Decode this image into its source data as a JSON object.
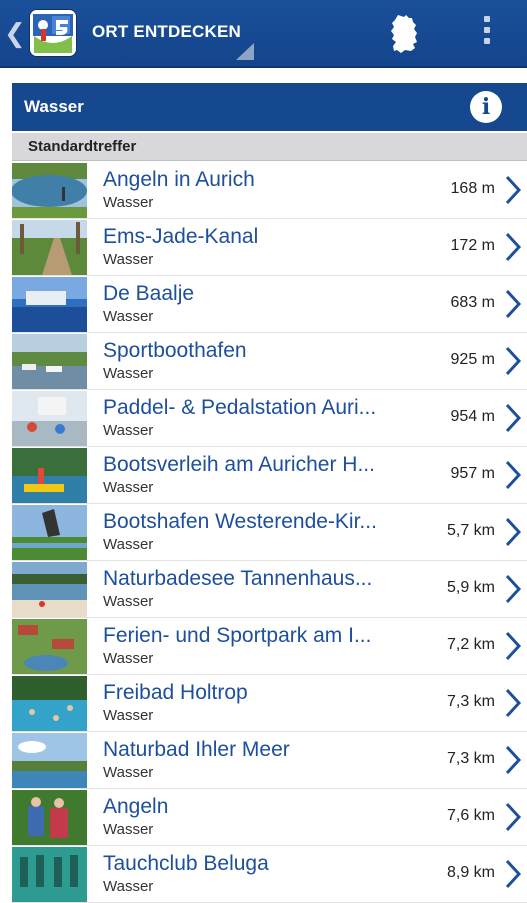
{
  "appbar": {
    "title": "ORT ENTDECKEN",
    "back_icon": "chevron-left-icon",
    "logo_icon": "app-logo-icon",
    "map_icon": "germany-map-icon",
    "menu_icon": "overflow-menu-icon",
    "color": "#14458c"
  },
  "category": {
    "title": "Wasser",
    "info_label": "i"
  },
  "section": {
    "label": "Standardtreffer"
  },
  "list": {
    "items": [
      {
        "title": "Angeln in Aurich",
        "subtitle": "Wasser",
        "distance": "168 m"
      },
      {
        "title": "Ems-Jade-Kanal",
        "subtitle": "Wasser",
        "distance": "172 m"
      },
      {
        "title": "De Baalje",
        "subtitle": "Wasser",
        "distance": "683 m"
      },
      {
        "title": "Sportboothafen",
        "subtitle": "Wasser",
        "distance": "925 m"
      },
      {
        "title": "Paddel- & Pedalstation Auri...",
        "subtitle": "Wasser",
        "distance": "954 m"
      },
      {
        "title": "Bootsverleih am Auricher H...",
        "subtitle": "Wasser",
        "distance": "957 m"
      },
      {
        "title": "Bootshafen Westerende-Kir...",
        "subtitle": "Wasser",
        "distance": "5,7 km"
      },
      {
        "title": "Naturbadesee Tannenhaus...",
        "subtitle": "Wasser",
        "distance": "5,9 km"
      },
      {
        "title": "Ferien- und Sportpark am I...",
        "subtitle": "Wasser",
        "distance": "7,2 km"
      },
      {
        "title": "Freibad Holtrop",
        "subtitle": "Wasser",
        "distance": "7,3 km"
      },
      {
        "title": "Naturbad Ihler Meer",
        "subtitle": "Wasser",
        "distance": "7,3 km"
      },
      {
        "title": "Angeln",
        "subtitle": "Wasser",
        "distance": "7,6 km"
      },
      {
        "title": "Tauchclub Beluga",
        "subtitle": "Wasser",
        "distance": "8,9 km"
      }
    ]
  }
}
